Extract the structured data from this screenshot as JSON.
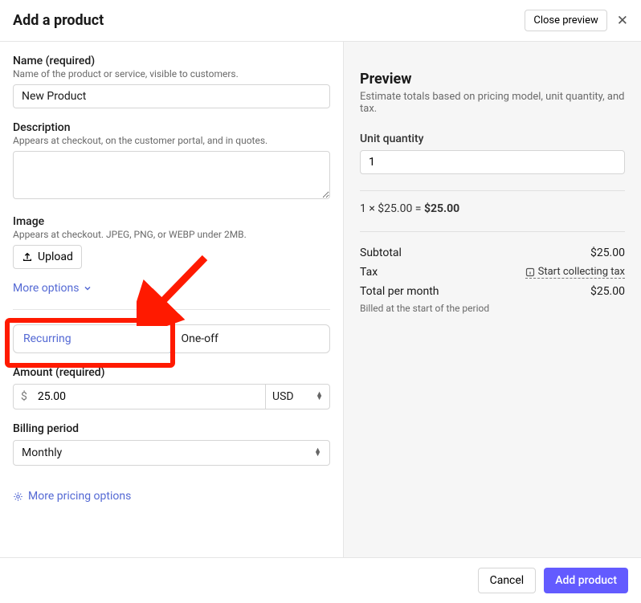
{
  "header": {
    "title": "Add a product",
    "close_preview": "Close preview"
  },
  "name": {
    "label": "Name (required)",
    "hint": "Name of the product or service, visible to customers.",
    "value": "New Product"
  },
  "description": {
    "label": "Description",
    "hint": "Appears at checkout, on the customer portal, and in quotes."
  },
  "image": {
    "label": "Image",
    "hint": "Appears at checkout. JPEG, PNG, or WEBP under 2MB.",
    "upload": "Upload"
  },
  "more_options": "More options",
  "pricing_toggle": {
    "recurring": "Recurring",
    "one_off": "One-off"
  },
  "amount": {
    "label": "Amount (required)",
    "symbol": "$",
    "value": "25.00",
    "currency": "USD"
  },
  "billing_period": {
    "label": "Billing period",
    "value": "Monthly"
  },
  "more_pricing": "More pricing options",
  "preview": {
    "title": "Preview",
    "subtitle": "Estimate totals based on pricing model, unit quantity, and tax.",
    "unit_qty_label": "Unit quantity",
    "unit_qty_value": "1",
    "calc_prefix": "1 × $25.00 = ",
    "calc_total": "$25.00",
    "subtotal_label": "Subtotal",
    "subtotal_value": "$25.00",
    "tax_label": "Tax",
    "tax_link": "Start collecting tax",
    "total_label": "Total per month",
    "total_value": "$25.00",
    "billed": "Billed at the start of the period"
  },
  "footer": {
    "cancel": "Cancel",
    "add": "Add product"
  }
}
